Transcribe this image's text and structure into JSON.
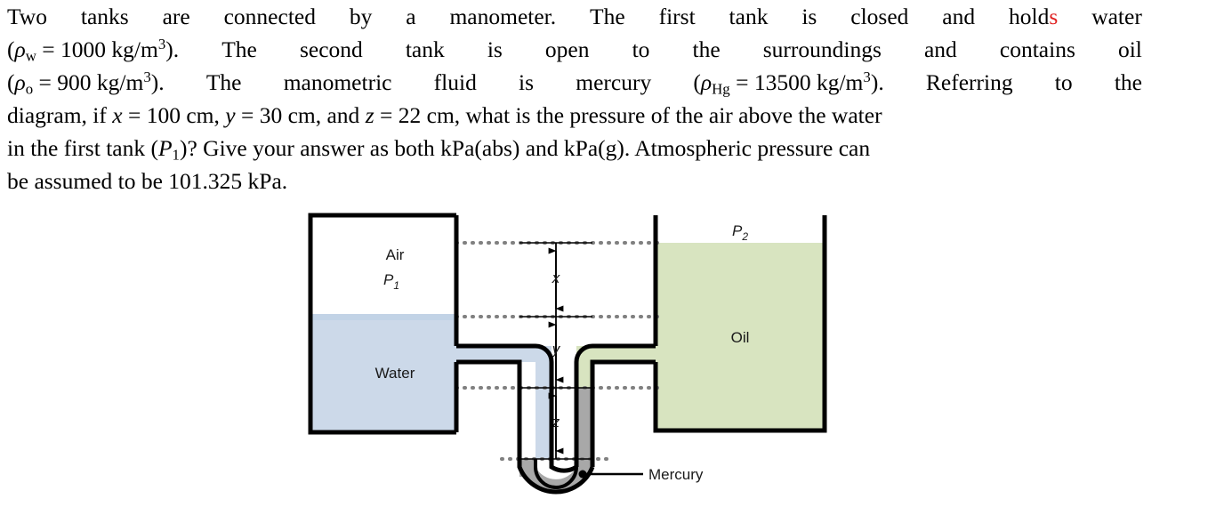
{
  "problem": {
    "lines": [
      [
        "Two",
        "tanks",
        "are",
        "connected",
        "by",
        "a",
        "manometer.",
        "The",
        "first",
        "tank",
        "is",
        "closed",
        "and",
        "hold",
        "water"
      ],
      [
        "The",
        "second",
        "tank",
        "is",
        "open",
        "to",
        "the",
        "surroundings",
        "and",
        "contains",
        "oil"
      ],
      [
        "The",
        "manometric",
        "fluid",
        "is",
        "mercury"
      ],
      [],
      [],
      []
    ],
    "line1_words": [
      "Two",
      "tanks",
      "are",
      "connected",
      "by",
      "a",
      "manometer.",
      "The",
      "first",
      "tank",
      "is",
      "closed",
      "and",
      "holds",
      "water"
    ],
    "line1_red_char": "s",
    "line2_prefix_rho": "ρ",
    "line2_rho_sub": "w",
    "line2_value": "= 1000 kg/m",
    "line2_exp": "3",
    "line2_words": [
      "The",
      "second",
      "tank",
      "is",
      "open",
      "to",
      "the",
      "surroundings",
      "and",
      "contains",
      "oil"
    ],
    "line3_rho_sub": "o",
    "line3_value": "= 900 kg/m",
    "line3_exp": "3",
    "line3_words_a": [
      "The",
      "manometric",
      "fluid",
      "is",
      "mercury"
    ],
    "line3_rho2_sub": "Hg",
    "line3_value2": "= 13500 kg/m",
    "line3_exp2": "3",
    "line3_words_b": [
      "Referring",
      "to",
      "the"
    ],
    "line4": "diagram, if x = 100 cm, y = 30 cm, and z = 22 cm, what is the pressure of the air above the water",
    "line4_parts": {
      "a": "diagram, if ",
      "x": "x",
      "b": " = 100 cm, ",
      "y": "y",
      "c": " = 30 cm, and ",
      "z": "z",
      "d": " = 22 cm, what is the pressure of the air above the water"
    },
    "line5_parts": {
      "a": "in the first tank (",
      "p": "P",
      "p_sub": "1",
      "b": ")? Give your answer as both kPa(abs) and kPa(g). Atmospheric pressure can"
    },
    "line6": "be assumed to be 101.325 kPa."
  },
  "diagram": {
    "labels": {
      "air": "Air",
      "p1": "P",
      "p1_sub": "1",
      "water": "Water",
      "oil": "Oil",
      "p2": "P",
      "p2_sub": "2",
      "mercury": "Mercury",
      "dim_x": "x",
      "dim_y": "y",
      "dim_z": "z"
    },
    "colors": {
      "water": "#ccd9e9",
      "water_top_band": "#c2d3e6",
      "oil": "#d8e4c0",
      "mercury": "#a8a8a8",
      "outline": "#000000",
      "dashed": "#808080"
    }
  },
  "values": {
    "rho_water": "1000 kg/m3",
    "rho_oil": "900 kg/m3",
    "rho_mercury": "13500 kg/m3",
    "x": "100 cm",
    "y": "30 cm",
    "z": "22 cm",
    "p_atm": "101.325 kPa"
  }
}
